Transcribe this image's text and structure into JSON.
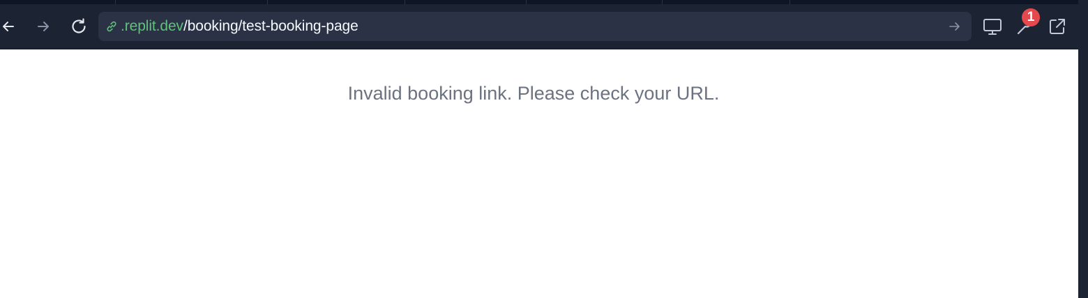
{
  "browser": {
    "url_host": ".replit.dev",
    "url_path": "/booking/test-booking-page",
    "notification_count": "1"
  },
  "icons": {
    "back": "arrow-left-icon",
    "forward": "arrow-right-icon",
    "reload": "reload-icon",
    "link": "link-icon",
    "go": "arrow-right-icon",
    "devices": "monitor-icon",
    "devtools": "wrench-icon",
    "open_new": "external-link-icon"
  },
  "colors": {
    "toolbar_bg": "#1c2333",
    "urlbar_bg": "#2b3245",
    "host_green": "#5fc27a",
    "badge_red": "#e5484d",
    "message_gray": "#6b7280"
  },
  "page": {
    "message": "Invalid booking link. Please check your URL."
  }
}
